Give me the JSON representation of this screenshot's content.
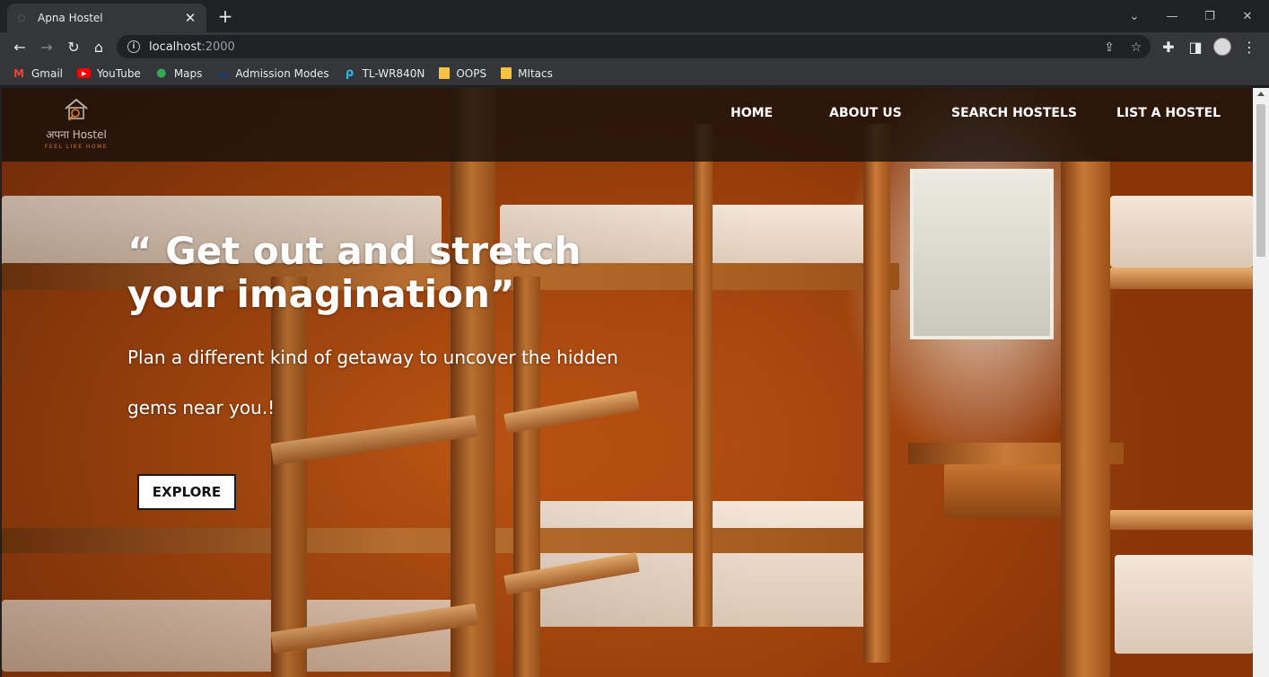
{
  "browser": {
    "tab_title": "Apna Hostel",
    "url_host": "localhost",
    "url_port": ":2000",
    "bookmarks": [
      {
        "label": "Gmail",
        "icon": "gmail-icon",
        "color": "#ea4335"
      },
      {
        "label": "YouTube",
        "icon": "youtube-icon",
        "color": "#ff0000"
      },
      {
        "label": "Maps",
        "icon": "maps-icon",
        "color": "#34a853"
      },
      {
        "label": "Admission Modes",
        "icon": "cloud-icon",
        "color": "#1a3a6a"
      },
      {
        "label": "TL-WR840N",
        "icon": "tplink-icon",
        "color": "#2bb6e8"
      },
      {
        "label": "OOPS",
        "icon": "folder-icon",
        "color": "#f5c242"
      },
      {
        "label": "MItacs",
        "icon": "folder-icon",
        "color": "#f5c242"
      }
    ]
  },
  "site": {
    "logo": {
      "brand": "अपना Hostel",
      "tagline": "FEEL LIKE HOME"
    },
    "nav": {
      "home": "HOME",
      "about": "ABOUT US",
      "search": "SEARCH HOSTELS",
      "list": "LIST A HOSTEL"
    },
    "hero": {
      "title_line1": "“ Get out and stretch",
      "title_line2": "your imagination”",
      "subtitle_line1": "Plan a different kind of getaway to uncover the hidden",
      "subtitle_line2": "gems near you.!",
      "cta": "EXPLORE"
    }
  },
  "colors": {
    "navbar_bg": "#120e0a",
    "accent_orange": "#d97a2a",
    "hero_text": "#ffffff"
  }
}
